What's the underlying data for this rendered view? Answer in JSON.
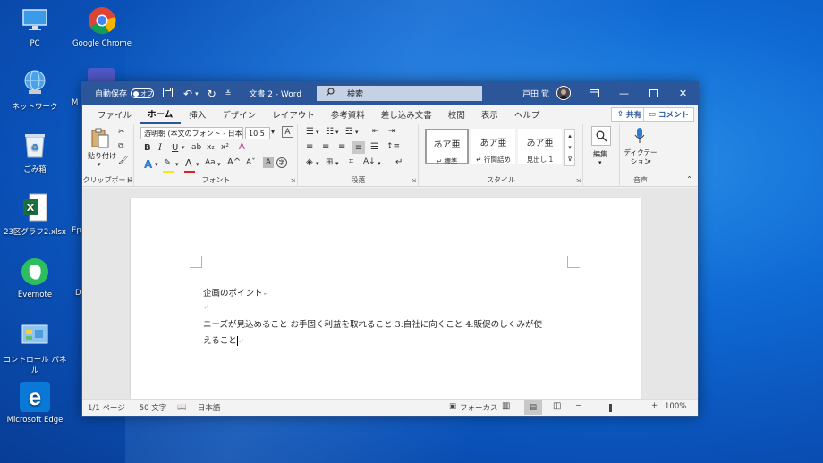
{
  "desktop": {
    "icons": [
      {
        "label": "PC"
      },
      {
        "label": "Google Chrome"
      },
      {
        "label": "ネットワーク"
      },
      {
        "label": "ごみ箱"
      },
      {
        "label": "23区グラフ2.xlsx"
      },
      {
        "label": "Evernote"
      },
      {
        "label": "コントロール パネル"
      },
      {
        "label": "Microsoft Edge"
      }
    ],
    "partial_labels": [
      "M",
      "Ep",
      "D"
    ]
  },
  "titlebar": {
    "autosave_label": "自動保存",
    "autosave_state": "オフ",
    "doc_title": "文書 2 - Word",
    "search_placeholder": "検索",
    "user_name": "戸田 覚"
  },
  "tabs": [
    "ファイル",
    "ホーム",
    "挿入",
    "デザイン",
    "レイアウト",
    "参考資料",
    "差し込み文書",
    "校閲",
    "表示",
    "ヘルプ"
  ],
  "active_tab": "ホーム",
  "share_label": "共有",
  "comment_label": "コメント",
  "ribbon": {
    "clipboard": {
      "paste_label": "貼り付け",
      "group_label": "クリップボード"
    },
    "font": {
      "font_name": "游明朝 (本文のフォント - 日本",
      "font_size": "10.5",
      "group_label": "フォント"
    },
    "paragraph": {
      "group_label": "段落"
    },
    "styles": {
      "group_label": "スタイル",
      "cards": [
        {
          "preview": "あア亜",
          "name": "標準"
        },
        {
          "preview": "あア亜",
          "name": "行間詰め"
        },
        {
          "preview": "あア亜",
          "name": "見出し 1"
        }
      ]
    },
    "editing": {
      "label": "編集"
    },
    "voice": {
      "dictate_label": "ディクテーション",
      "group_label": "音声"
    }
  },
  "document": {
    "lines": [
      "企画のポイント",
      "",
      "ニーズが見込めること お手固く利益を取れること 3:自社に向くこと 4:販促のしくみが使",
      "えること"
    ]
  },
  "status": {
    "page": "1/1 ページ",
    "words": "50 文字",
    "language": "日本語",
    "focus": "フォーカス",
    "zoom": "100%",
    "zoom_fraction": 0.5
  },
  "colors": {
    "word_blue": "#2b579a",
    "font_color_red": "#e02020",
    "highlight_yellow": "#ffe800"
  }
}
